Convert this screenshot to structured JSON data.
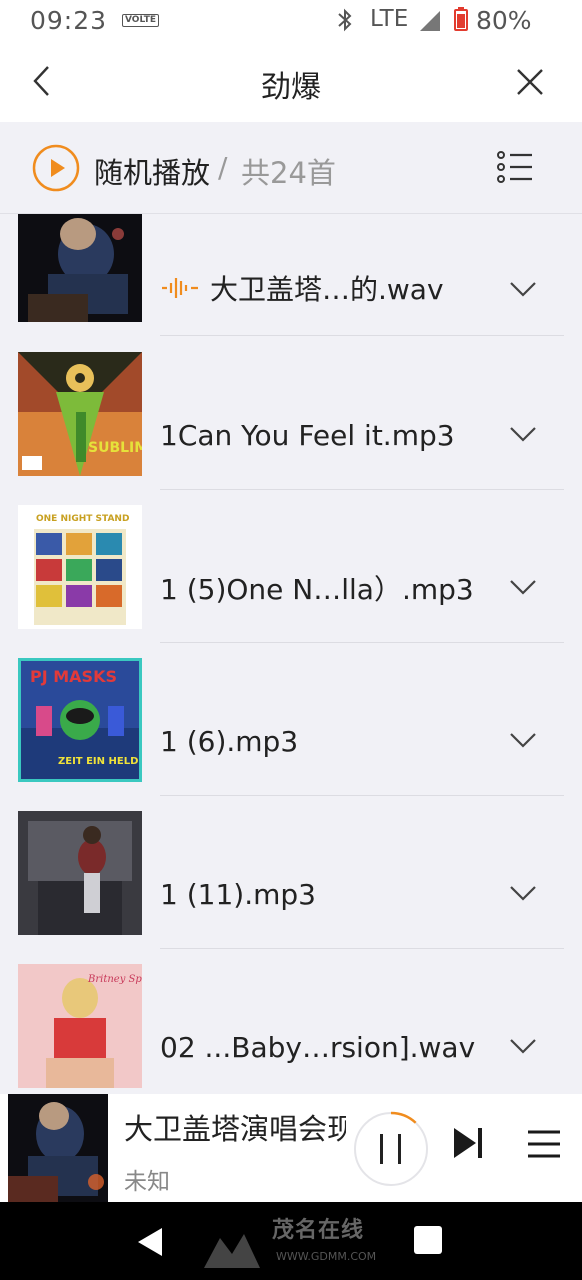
{
  "status_bar": {
    "time": "09:23",
    "volte": "VOLTE",
    "network": "LTE",
    "battery": "80%"
  },
  "header": {
    "title": "劲爆"
  },
  "shuffle": {
    "label": "随机播放",
    "separator": "/",
    "count": "共24首",
    "accent_color": "#f08c1e"
  },
  "songs": [
    {
      "title": "大卫盖塔…的.wav",
      "playing": true
    },
    {
      "title": "1Can You Feel it.mp3",
      "playing": false
    },
    {
      "title": "1 (5)One N…lla）.mp3",
      "playing": false
    },
    {
      "title": "1 (6).mp3",
      "playing": false
    },
    {
      "title": "1 (11).mp3",
      "playing": false
    },
    {
      "title": "02 ...Baby…rsion].wav",
      "playing": false
    }
  ],
  "now_playing": {
    "title": "大卫盖塔演唱会现场",
    "artist": "未知",
    "progress": 0.12
  },
  "nav": {
    "watermark": "茂名在线",
    "watermark_url": "WWW.GDMM.COM"
  }
}
